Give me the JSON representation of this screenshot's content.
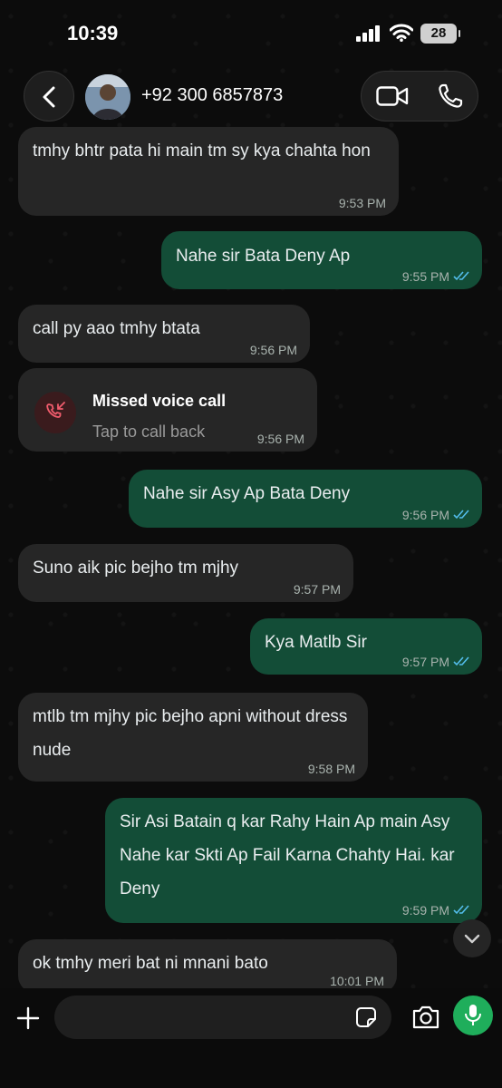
{
  "status_bar": {
    "time": "10:39",
    "battery": "28"
  },
  "header": {
    "contact": "+92 300 6857873"
  },
  "messages": [
    {
      "dir": "in",
      "text": "tmhy bhtr pata hi main tm sy kya chahta hon",
      "time": "9:53 PM"
    },
    {
      "dir": "out",
      "text": "Nahe sir  Bata Deny Ap",
      "time": "9:55 PM"
    },
    {
      "dir": "in",
      "text": "call py aao tmhy btata",
      "time": "9:56 PM"
    },
    {
      "dir": "in",
      "type": "call",
      "title": "Missed voice call",
      "subtitle": "Tap to call back",
      "time": "9:56 PM"
    },
    {
      "dir": "out",
      "text": "Nahe sir Asy Ap Bata Deny",
      "time": "9:56 PM"
    },
    {
      "dir": "in",
      "text": "Suno aik pic bejho tm mjhy",
      "time": "9:57 PM"
    },
    {
      "dir": "out",
      "text": "Kya Matlb Sir",
      "time": "9:57 PM"
    },
    {
      "dir": "in",
      "text": "mtlb tm mjhy pic bejho apni without dress nude",
      "time": "9:58 PM"
    },
    {
      "dir": "out",
      "text": "Sir Asi Batain q kar Rahy Hain Ap main Asy Nahe kar Skti Ap Fail Karna Chahty Hai. kar Deny",
      "time": "9:59 PM"
    },
    {
      "dir": "in",
      "text": "ok tmhy meri bat ni mnani bato",
      "time": "10:01 PM"
    }
  ],
  "composer": {
    "placeholder": ""
  },
  "colors": {
    "incoming": "#262626",
    "outgoing": "#134d37",
    "read_ticks": "#53bdeb",
    "missed": "#f15c6d",
    "mic": "#1fae5b"
  }
}
